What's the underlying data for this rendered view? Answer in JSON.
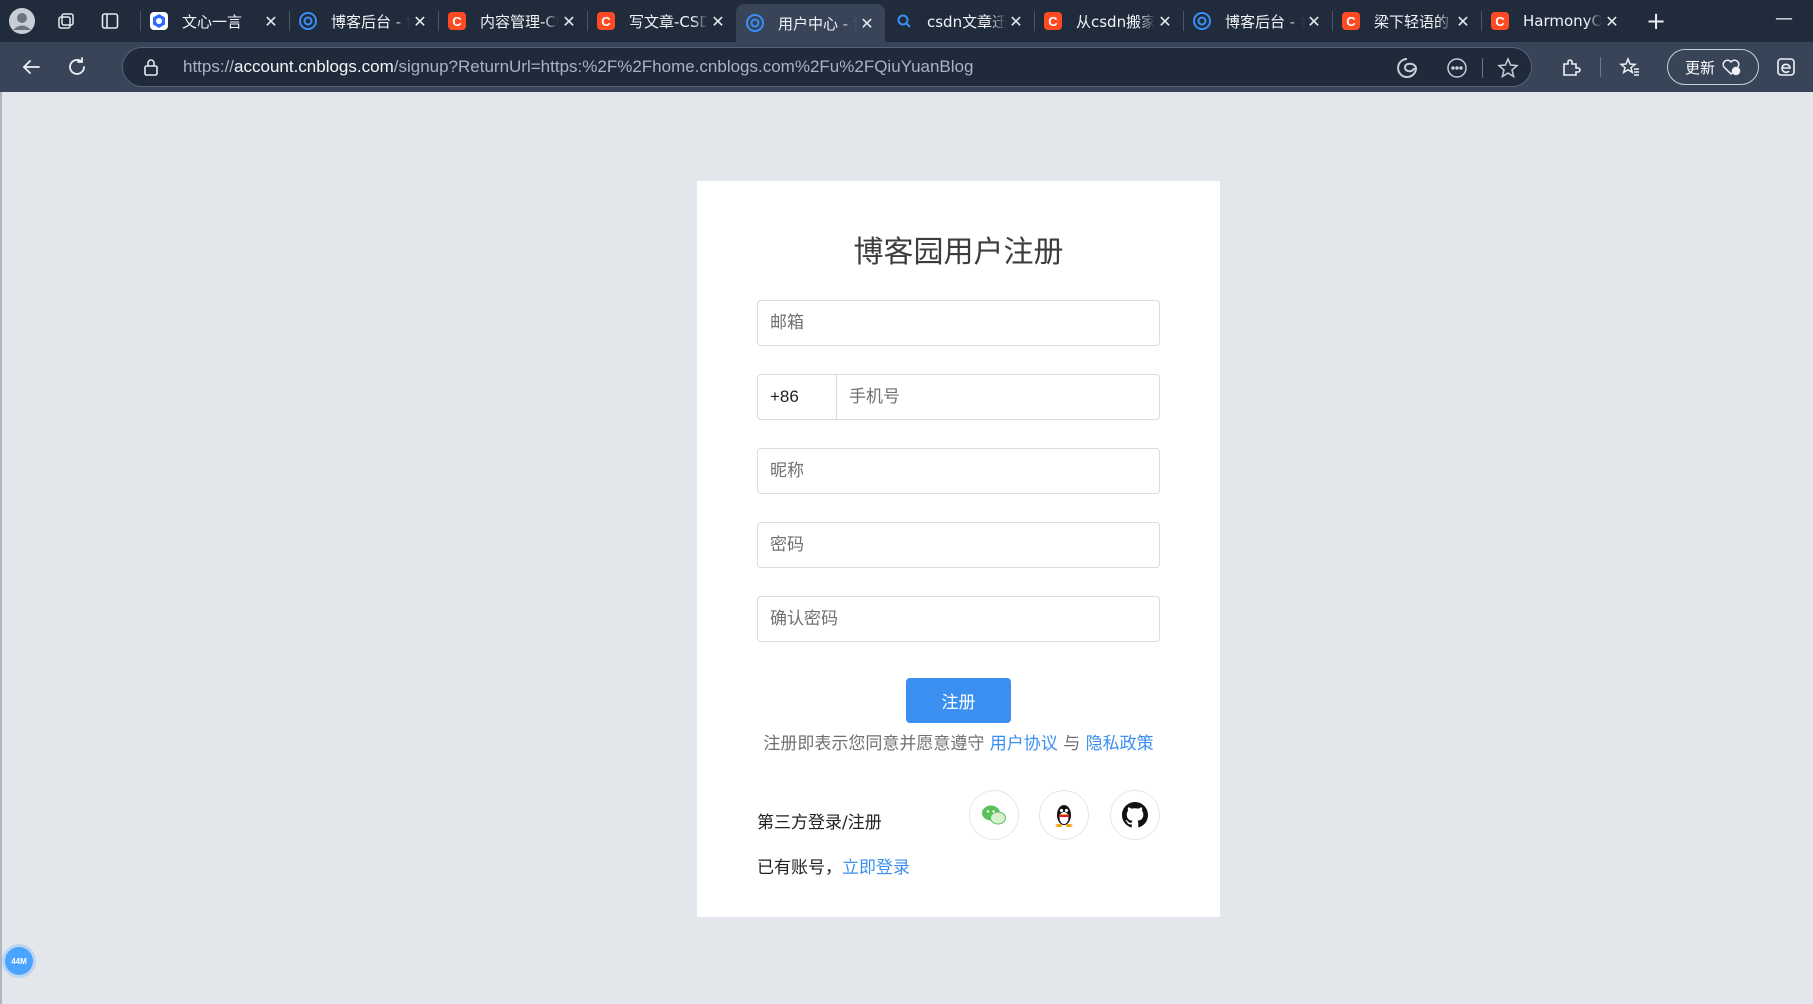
{
  "browser": {
    "tabs": [
      {
        "title": "文心一言",
        "favicon": "wenxin-icon",
        "active": false
      },
      {
        "title": "博客后台 - 博客园",
        "favicon": "cnblogs-icon",
        "active": false
      },
      {
        "title": "内容管理-CSDN",
        "favicon": "csdn-icon",
        "active": false
      },
      {
        "title": "写文章-CSDN",
        "favicon": "csdn-icon",
        "active": false
      },
      {
        "title": "用户中心 - 博客园",
        "favicon": "cnblogs-icon",
        "active": true
      },
      {
        "title": "csdn文章迁移",
        "favicon": "search-icon",
        "active": false
      },
      {
        "title": "从csdn搬家",
        "favicon": "csdn-icon",
        "active": false
      },
      {
        "title": "博客后台 - 博客园",
        "favicon": "cnblogs-icon",
        "active": false
      },
      {
        "title": "梁下轻语的",
        "favicon": "csdn-icon",
        "active": false
      },
      {
        "title": "HarmonyOS",
        "favicon": "csdn-icon",
        "active": false
      }
    ],
    "csdn_letter": "C",
    "address": {
      "scheme": "https://",
      "host": "account.cnblogs.com",
      "path": "/signup?ReturnUrl=https:%2F%2Fhome.cnblogs.com%2Fu%2FQiuYuanBlog"
    },
    "update_label": "更新"
  },
  "form": {
    "title": "博客园用户注册",
    "email_placeholder": "邮箱",
    "phone_prefix": "+86",
    "phone_placeholder": "手机号",
    "nickname_placeholder": "昵称",
    "password_placeholder": "密码",
    "confirm_placeholder": "确认密码",
    "submit_label": "注册",
    "agreement_prefix": "注册即表示您同意并愿意遵守 ",
    "user_agreement": "用户协议",
    "agreement_and": " 与 ",
    "privacy_policy": "隐私政策",
    "third_party_label": "第三方登录/注册",
    "have_account": "已有账号，",
    "login_link": "立即登录"
  },
  "floating_badge": "44M",
  "colors": {
    "accent": "#3b8ff0",
    "tabbar": "#202b3c",
    "toolbar": "#384559",
    "page_bg": "#e3e6ea",
    "csdn_red": "#ff4a24"
  }
}
